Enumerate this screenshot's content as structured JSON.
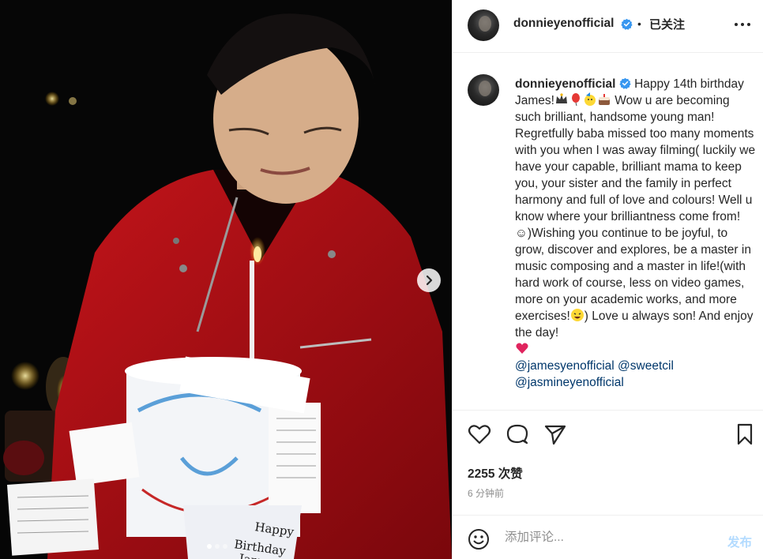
{
  "post": {
    "username": "donnieyenofficial",
    "follow_state": "已关注",
    "caption_line1": "Happy 14th birthday James!",
    "caption_body": "Wow u are becoming such brilliant, handsome young man! Regretfully baba missed too many moments with you when I was away filming( luckily we have your capable, brilliant mama to keep you, your sister and the family in perfect harmony and full of love and colours! Well u know where your brilliantness come from!",
    "caption_smile": "☺",
    "caption_body2": ")Wishing you continue to be joyful, to grow, discover and explores, be a master in music composing and a master in life!(with hard work of course, less on video games, more on your academic works, and more exercises!",
    "caption_body3": ") Love u always son! And enjoy the day!",
    "mentions": [
      "@jamesyenofficial",
      "@sweetcil",
      "@jasmineyenofficial"
    ],
    "likes_text": "2255 次赞",
    "time_text": "6 分钟前"
  },
  "comment": {
    "placeholder": "添加评论...",
    "post_label": "发布"
  },
  "photo": {
    "cake_text_1": "Happy",
    "cake_text_2": "Birthday",
    "cake_text_3": "Jame",
    "carousel_total": 3,
    "carousel_active": 1
  },
  "icons": {
    "verified": "verified-badge-icon",
    "more": "more-options-icon",
    "like": "heart-icon",
    "comment": "comment-icon",
    "share": "share-icon",
    "save": "bookmark-icon",
    "emoji": "emoji-icon",
    "next": "chevron-right-icon"
  },
  "colors": {
    "verified": "#3897f0",
    "mention": "#00376b",
    "post_button": "#b3dbff",
    "heart_emoji": "#e0245e"
  }
}
